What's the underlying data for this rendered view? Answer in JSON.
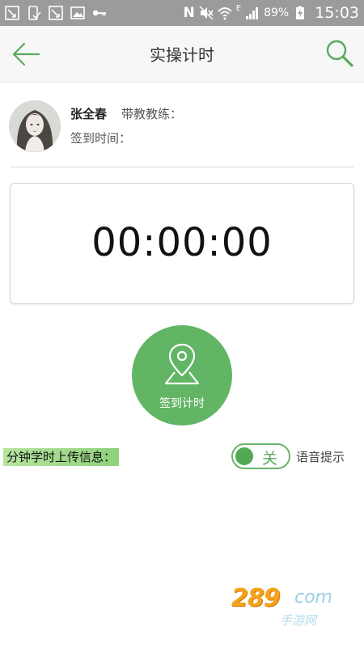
{
  "status_bar": {
    "network_label": "N",
    "data_label": "E",
    "battery": "89%",
    "time": "15:03"
  },
  "header": {
    "title": "实操计时",
    "accent_color": "#5aa95c"
  },
  "profile": {
    "name": "张全春",
    "coach_label": "带教教练：",
    "checkin_time_label": "签到时间："
  },
  "timer": {
    "value": "00:00:00"
  },
  "checkin_button": {
    "label": "签到计时",
    "color": "#62b565"
  },
  "bottom": {
    "upload_info_label": "分钟学时上传信息：",
    "voice_toggle_state": "关",
    "voice_label": "语音提示"
  },
  "watermark": {
    "brand": "289",
    "suffix": "com",
    "subtitle": "手游网"
  }
}
